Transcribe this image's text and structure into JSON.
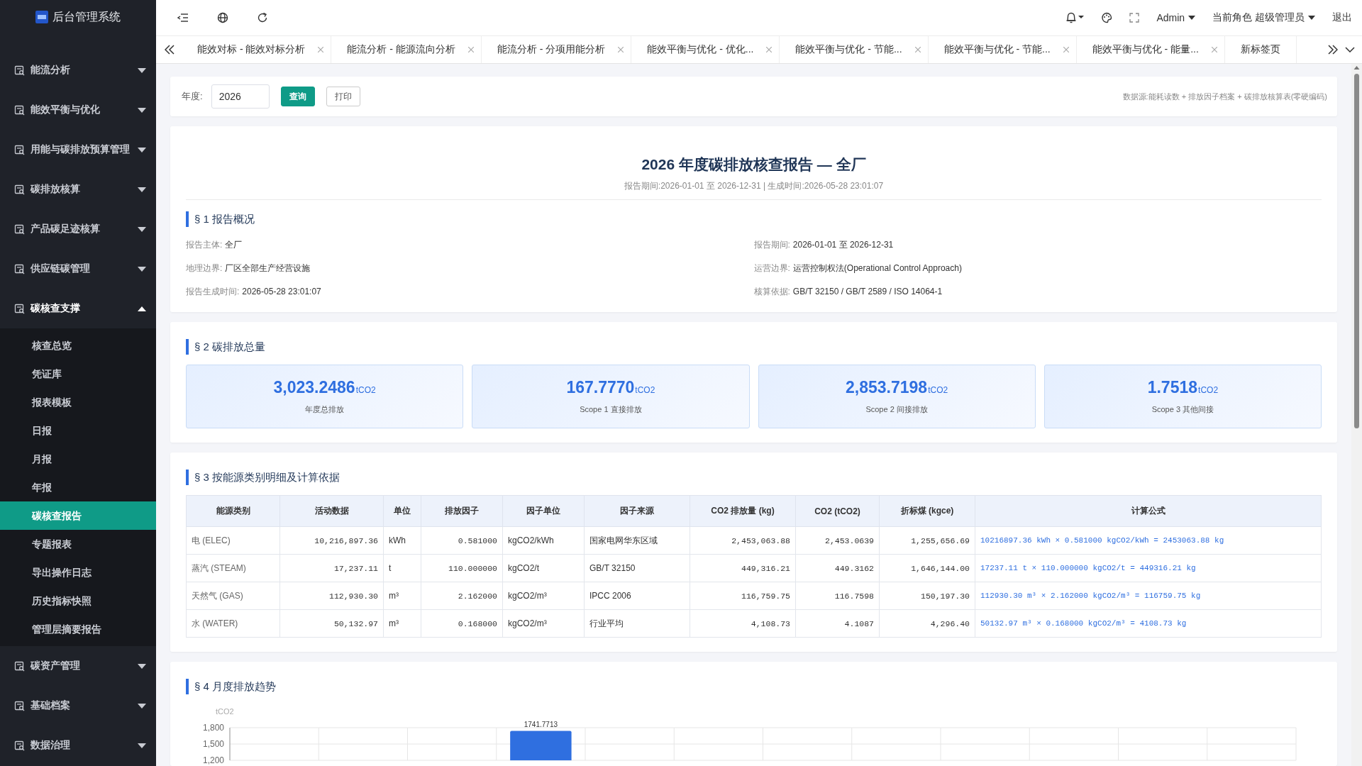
{
  "app": {
    "title": "后台管理系统"
  },
  "sidebar": {
    "items": [
      {
        "label": "能流分析",
        "expanded": false
      },
      {
        "label": "能效平衡与优化",
        "expanded": false
      },
      {
        "label": "用能与碳排放预算管理",
        "expanded": false
      },
      {
        "label": "碳排放核算",
        "expanded": false
      },
      {
        "label": "产品碳足迹核算",
        "expanded": false
      },
      {
        "label": "供应链碳管理",
        "expanded": false
      },
      {
        "label": "碳核查支撑",
        "expanded": true,
        "children": [
          {
            "label": "核查总览",
            "selected": false
          },
          {
            "label": "凭证库",
            "selected": false
          },
          {
            "label": "报表模板",
            "selected": false
          },
          {
            "label": "日报",
            "selected": false
          },
          {
            "label": "月报",
            "selected": false
          },
          {
            "label": "年报",
            "selected": false
          },
          {
            "label": "碳核查报告",
            "selected": true
          },
          {
            "label": "专题报表",
            "selected": false
          },
          {
            "label": "导出操作日志",
            "selected": false
          },
          {
            "label": "历史指标快照",
            "selected": false
          },
          {
            "label": "管理层摘要报告",
            "selected": false
          }
        ]
      },
      {
        "label": "碳资产管理",
        "expanded": false
      },
      {
        "label": "基础档案",
        "expanded": false
      },
      {
        "label": "数据治理",
        "expanded": false
      }
    ]
  },
  "header": {
    "user": "Admin",
    "role": "当前角色 超级管理员",
    "logout": "退出"
  },
  "tabs": [
    {
      "label": "能效对标 - 能效对标分析",
      "closable": true,
      "selected": false
    },
    {
      "label": "能流分析 - 能源流向分析",
      "closable": true,
      "selected": false
    },
    {
      "label": "能流分析 - 分项用能分析",
      "closable": true,
      "selected": false
    },
    {
      "label": "能效平衡与优化 - 优化...",
      "closable": true,
      "selected": false
    },
    {
      "label": "能效平衡与优化 - 节能...",
      "closable": true,
      "selected": false
    },
    {
      "label": "能效平衡与优化 - 节能...",
      "closable": true,
      "selected": false
    },
    {
      "label": "能效平衡与优化 - 能量...",
      "closable": true,
      "selected": false
    },
    {
      "label": "新标签页",
      "closable": false,
      "selected": false
    }
  ],
  "filter": {
    "label": "年度:",
    "value": "2026",
    "query_button": "查询",
    "print_button": "打印",
    "source_note": "数据源:能耗读数 + 排放因子档案 + 碳排放核算表(零硬编码)"
  },
  "report": {
    "title": "2026 年度碳排放核查报告 — 全厂",
    "subtitle": "报告期间:2026-01-01 至 2026-12-31 | 生成时间:2026-05-28 23:01:07",
    "sections": [
      {
        "kind": "info",
        "heading": "§ 1 报告概况",
        "fields": [
          {
            "label": "报告主体:",
            "value": "全厂"
          },
          {
            "label": "报告期间:",
            "value": "2026-01-01 至 2026-12-31"
          },
          {
            "label": "地理边界:",
            "value": "厂区全部生产经营设施"
          },
          {
            "label": "运营边界:",
            "value": "运营控制权法(Operational Control Approach)"
          },
          {
            "label": "报告生成时间:",
            "value": "2026-05-28 23:01:07"
          },
          {
            "label": "核算依据:",
            "value": "GB/T 32150 / GB/T 2589 / ISO 14064-1"
          }
        ]
      },
      {
        "kind": "totals",
        "heading": "§ 2 碳排放总量",
        "cards": [
          {
            "value": "3,023.2486",
            "unit": "tCO2",
            "label": "年度总排放"
          },
          {
            "value": "167.7770",
            "unit": "tCO2",
            "label": "Scope 1 直接排放"
          },
          {
            "value": "2,853.7198",
            "unit": "tCO2",
            "label": "Scope 2 间接排放"
          },
          {
            "value": "1.7518",
            "unit": "tCO2",
            "label": "Scope 3 其他间接"
          }
        ]
      },
      {
        "kind": "table",
        "heading": "§ 3 按能源类别明细及计算依据",
        "columns": [
          "能源类别",
          "活动数据",
          "单位",
          "排放因子",
          "因子单位",
          "因子来源",
          "CO2 排放量 (kg)",
          "CO2 (tCO2)",
          "折标煤 (kgce)",
          "计算公式"
        ],
        "rows": [
          [
            "电 (ELEC)",
            "10,216,897.36",
            "kWh",
            "0.581000",
            "kgCO2/kWh",
            "国家电网华东区域",
            "2,453,063.88",
            "2,453.0639",
            "1,255,656.69",
            "10216897.36 kWh × 0.581000 kgCO2/kWh = 2453063.88 kg"
          ],
          [
            "蒸汽 (STEAM)",
            "17,237.11",
            "t",
            "110.000000",
            "kgCO2/t",
            "GB/T 32150",
            "449,316.21",
            "449.3162",
            "1,646,144.00",
            "17237.11 t × 110.000000 kgCO2/t = 449316.21 kg"
          ],
          [
            "天然气 (GAS)",
            "112,930.30",
            "m³",
            "2.162000",
            "kgCO2/m³",
            "IPCC 2006",
            "116,759.75",
            "116.7598",
            "150,197.30",
            "112930.30 m³ × 2.162000 kgCO2/m³ = 116759.75 kg"
          ],
          [
            "水 (WATER)",
            "50,132.97",
            "m³",
            "0.168000",
            "kgCO2/m³",
            "行业平均",
            "4,108.73",
            "4.1087",
            "4,296.40",
            "50132.97 m³ × 0.168000 kgCO2/m³ = 4108.73 kg"
          ]
        ]
      },
      {
        "kind": "chart",
        "heading": "§ 4 月度排放趋势",
        "chart_data": {
          "type": "bar",
          "ylabel": "tCO2",
          "yticks": [
            {
              "value": 1200,
              "label": "1,200"
            },
            {
              "value": 1500,
              "label": "1,500"
            },
            {
              "value": 1800,
              "label": "1,800"
            }
          ],
          "ylim": [
            1200,
            1800
          ],
          "values": [
            null,
            null,
            null,
            1741.7713,
            null,
            null,
            null,
            null,
            null,
            null,
            null,
            null
          ],
          "data_labels": true
        }
      }
    ]
  }
}
